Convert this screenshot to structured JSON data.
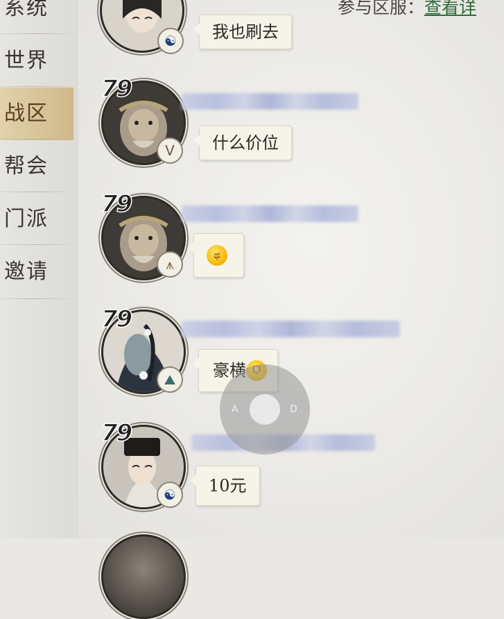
{
  "sidebar": {
    "items": [
      {
        "label": "系统",
        "active": false
      },
      {
        "label": "世界",
        "active": false
      },
      {
        "label": "战区",
        "active": true
      },
      {
        "label": "帮会",
        "active": false
      },
      {
        "label": "门派",
        "active": false
      },
      {
        "label": "邀请",
        "active": false
      }
    ]
  },
  "header": {
    "server_label": "参与区服：",
    "server_link": "查看详"
  },
  "messages": [
    {
      "level": "",
      "badge_icon": "taiji-icon",
      "badge_glyph": "☯",
      "text": "我也刷去",
      "emoji": ""
    },
    {
      "level": "79",
      "badge_icon": "shield-v-icon",
      "badge_glyph": "V",
      "text": "什么价位",
      "emoji": ""
    },
    {
      "level": "79",
      "badge_icon": "temple-icon",
      "badge_glyph": "⩚",
      "text": "",
      "emoji": "sweat-emoji"
    },
    {
      "level": "79",
      "badge_icon": "mountain-icon",
      "badge_glyph": "⛰",
      "text": "豪横",
      "emoji": "grin-emoji"
    },
    {
      "level": "79",
      "badge_icon": "taiji-icon",
      "badge_glyph": "☯",
      "text": "10元",
      "emoji": ""
    }
  ],
  "joystick": {
    "left_label": "A",
    "right_label": "D"
  },
  "colors": {
    "active_tab": "#cfb98a",
    "link": "#2f6b3a",
    "bubble": "#f6f4e9"
  }
}
